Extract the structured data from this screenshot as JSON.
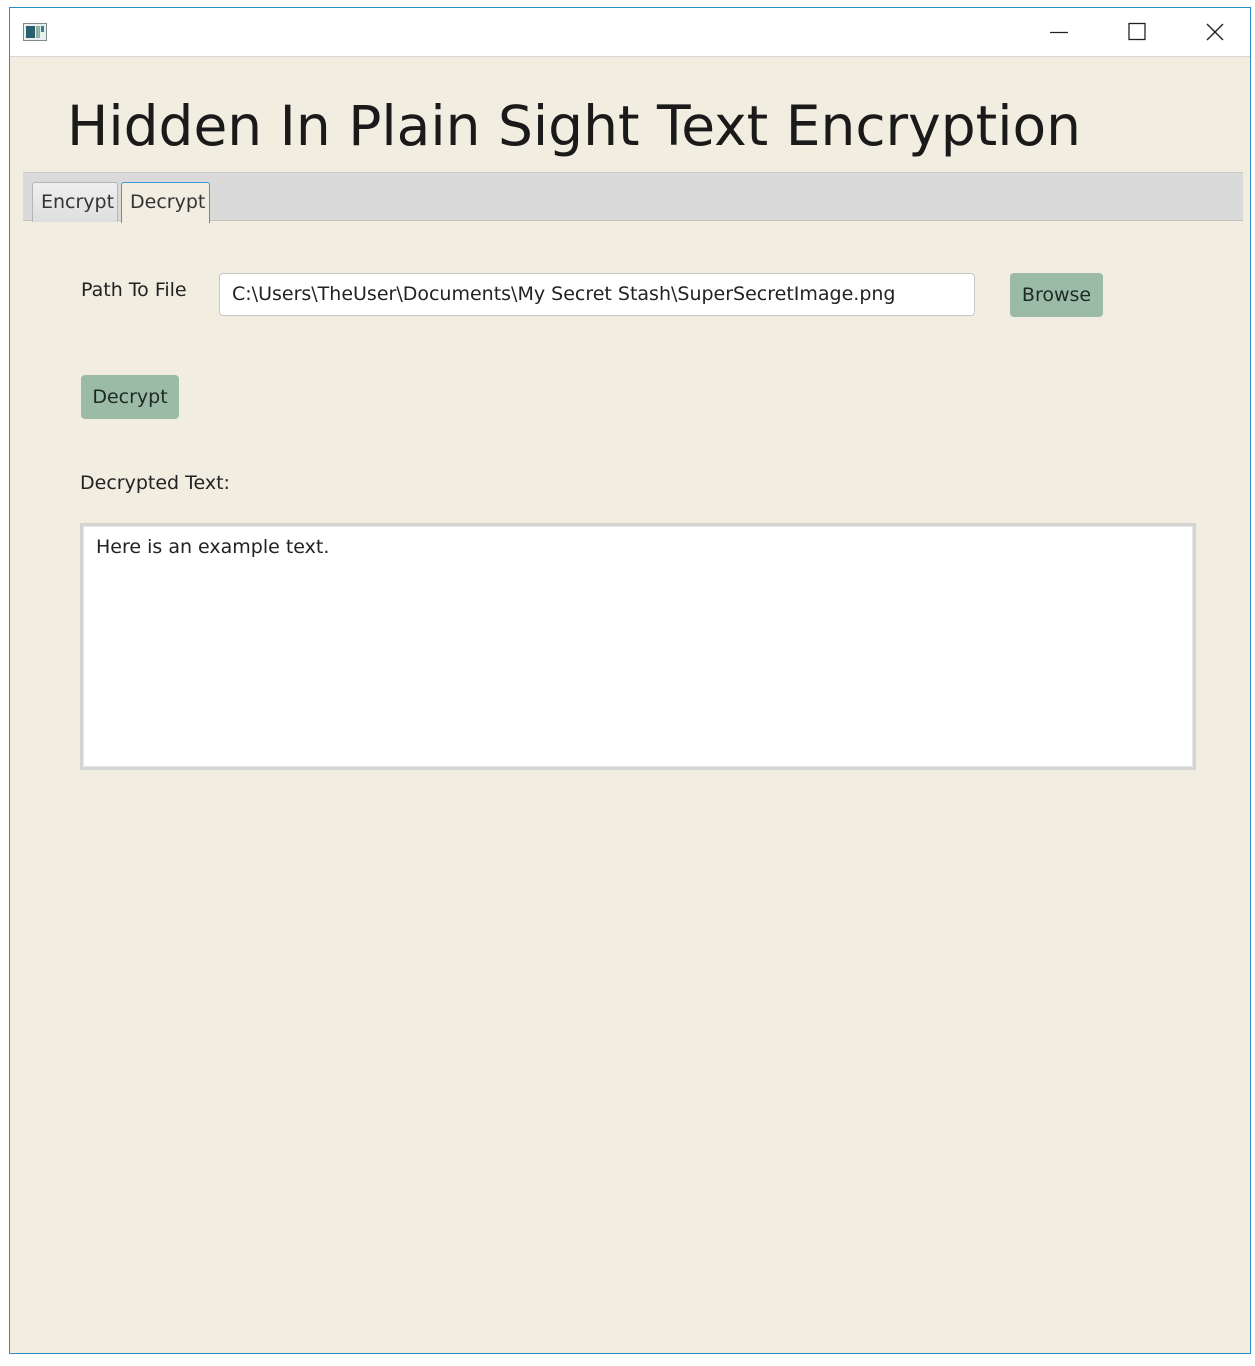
{
  "window": {
    "controls": {
      "minimize_icon": "minimize-icon",
      "maximize_icon": "maximize-icon",
      "close_icon": "close-icon"
    }
  },
  "app": {
    "title": "Hidden In Plain Sight Text Encryption"
  },
  "tabs": [
    {
      "label": "Encrypt",
      "selected": false
    },
    {
      "label": "Decrypt",
      "selected": true
    }
  ],
  "decrypt": {
    "path_label": "Path To File",
    "path_value": "C:\\Users\\TheUser\\Documents\\My Secret Stash\\SuperSecretImage.png",
    "browse_label": "Browse",
    "decrypt_label": "Decrypt",
    "decrypted_text_label": "Decrypted Text:",
    "decrypted_text_value": "Here is an example text."
  },
  "colors": {
    "background": "#f1ede0",
    "button": "#9cbba7",
    "tab_focus": "#3e9ad3",
    "window_border": "#2c8ec8"
  }
}
